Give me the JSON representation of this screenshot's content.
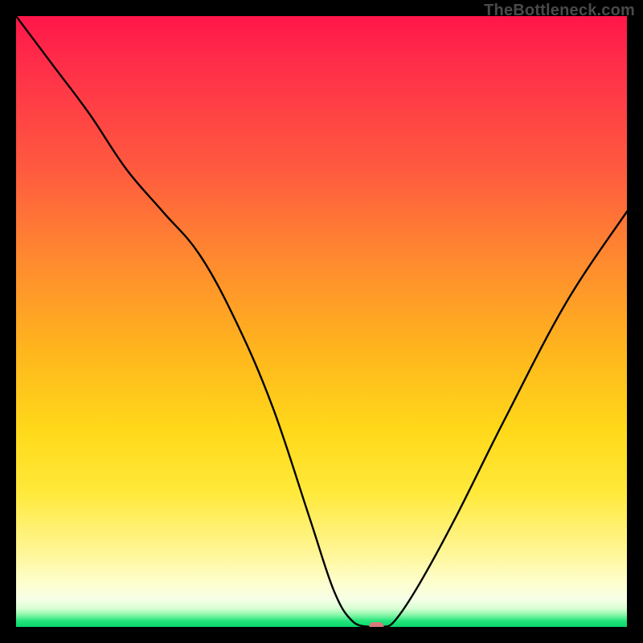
{
  "watermark": "TheBottleneck.com",
  "colors": {
    "background": "#000000",
    "curve": "#000000",
    "marker": "#d47a7d",
    "gradient_stops": [
      "#ff1649",
      "#ff2e49",
      "#ff5a3f",
      "#ff8a2f",
      "#ffb61d",
      "#ffd91a",
      "#ffe93a",
      "#fff698",
      "#fdffd0",
      "#f6ffe6",
      "#d7ffd3",
      "#8cf7ab",
      "#23e57a",
      "#0bd66a"
    ]
  },
  "chart_data": {
    "type": "line",
    "title": "",
    "xlabel": "",
    "ylabel": "",
    "xlim": [
      0,
      100
    ],
    "ylim": [
      0,
      100
    ],
    "grid": false,
    "legend": false,
    "series": [
      {
        "name": "bottleneck-curve",
        "x": [
          0,
          6,
          12,
          18,
          24,
          30,
          36,
          42,
          48,
          52,
          55,
          58,
          60,
          62,
          66,
          72,
          80,
          90,
          100
        ],
        "values": [
          100,
          92,
          84,
          75,
          68,
          61,
          50,
          36,
          18,
          6,
          1,
          0,
          0,
          1,
          7,
          18,
          34,
          53,
          68
        ]
      }
    ],
    "annotations": [
      {
        "name": "min-marker",
        "x": 59,
        "y": 0,
        "shape": "rounded-rect"
      }
    ],
    "notes": "y is qualitative bottleneck level (0 = none, 100 = severe); x is qualitative balance axis. Values estimated from pixel positions — chart has no numeric axes."
  }
}
